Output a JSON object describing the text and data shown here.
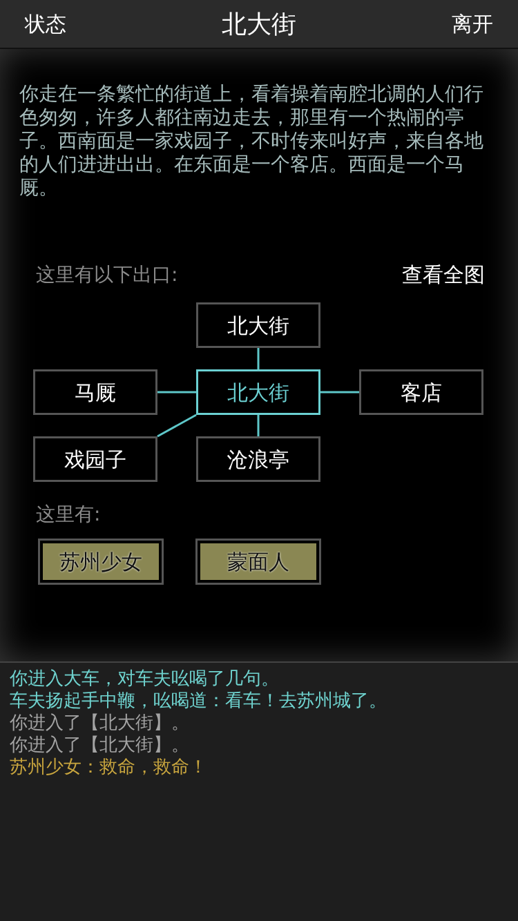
{
  "header": {
    "left": "状态",
    "title": "北大街",
    "right": "离开"
  },
  "description": "你走在一条繁忙的街道上，看着操着南腔北调的人们行色匆匆，许多人都往南边走去，那里有一个热闹的亭子。西南面是一家戏园子，不时传来叫好声，来自各地的人们进进出出。在东面是一个客店。西面是一个马厩。",
  "exits_label": "这里有以下出口:",
  "full_map": "查看全图",
  "map": [
    {
      "kind": "north",
      "name": "北大街",
      "selected": false
    },
    {
      "kind": "west",
      "name": "马厩",
      "selected": false
    },
    {
      "kind": "center",
      "name": "北大街",
      "selected": true
    },
    {
      "kind": "east",
      "name": "客店",
      "selected": false
    },
    {
      "kind": "southwest",
      "name": "戏园子",
      "selected": false
    },
    {
      "kind": "south",
      "name": "沧浪亭",
      "selected": false
    }
  ],
  "npcs_label": "这里有:",
  "npcs": [
    "苏州少女",
    "蒙面人"
  ],
  "log": [
    {
      "text": "你进入大车，对车夫吆喝了几句。",
      "color": "#6fd3cf"
    },
    {
      "text": "车夫扬起手中鞭，吆喝道：看车！去苏州城了。",
      "color": "#6fd3cf"
    },
    {
      "text": "你进入了【北大街】。",
      "color": "#a3a3a3"
    },
    {
      "text": "你进入了【北大街】。",
      "color": "#a3a3a3"
    },
    {
      "text": "苏州少女：救命，救命！",
      "color": "#c8a53e"
    }
  ]
}
